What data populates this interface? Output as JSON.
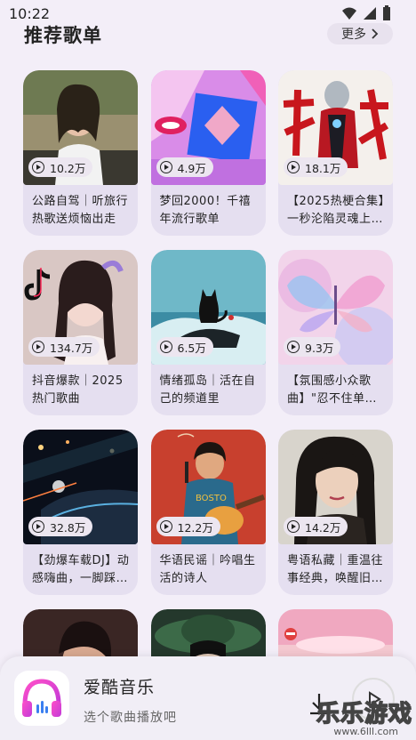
{
  "status_bar": {
    "time": "10:22"
  },
  "section": {
    "title": "推荐歌单",
    "more_label": "更多"
  },
  "playlists": [
    {
      "title": "公路自驾｜听旅行热歌送烦恼出走",
      "plays": "10.2万",
      "cover": "girl-road-photo"
    },
    {
      "title": "梦回2000！千禧年流行歌单",
      "plays": "4.9万",
      "cover": "y2k-collage"
    },
    {
      "title": "【2025热梗合集】一秒沦陷灵魂上…",
      "plays": "18.1万",
      "cover": "ultraman-calligraphy"
    },
    {
      "title": "抖音爆款｜2025热门歌曲",
      "plays": "134.7万",
      "cover": "tiktok-girl"
    },
    {
      "title": "情绪孤岛｜活在自己的频道里",
      "plays": "6.5万",
      "cover": "cat-on-rock"
    },
    {
      "title": "【氛围感小众歌曲】\"忍不住单曲…",
      "plays": "9.3万",
      "cover": "butterfly-art"
    },
    {
      "title": "【劲爆车载DJ】动感嗨曲，一脚踩…",
      "plays": "32.8万",
      "cover": "night-car"
    },
    {
      "title": "华语民谣｜吟唱生活的诗人",
      "plays": "12.2万",
      "cover": "guitar-boy-illustration"
    },
    {
      "title": "粤语私藏｜重温往事经典，唤醒旧…",
      "plays": "14.2万",
      "cover": "retro-woman-portrait"
    },
    {
      "title": "",
      "plays": "",
      "cover": "dark-portrait"
    },
    {
      "title": "",
      "plays": "",
      "cover": "green-hat-woman"
    },
    {
      "title": "",
      "plays": "",
      "cover": "pink-sunset"
    }
  ],
  "player": {
    "app_name": "爱酷音乐",
    "hint": "选个歌曲播放吧"
  },
  "watermark": {
    "text": "乐乐游戏",
    "url": "www.6lll.com"
  },
  "colors": {
    "accent": "#e53dd6",
    "background": "#f3eef8",
    "card": "#e5dff0"
  }
}
